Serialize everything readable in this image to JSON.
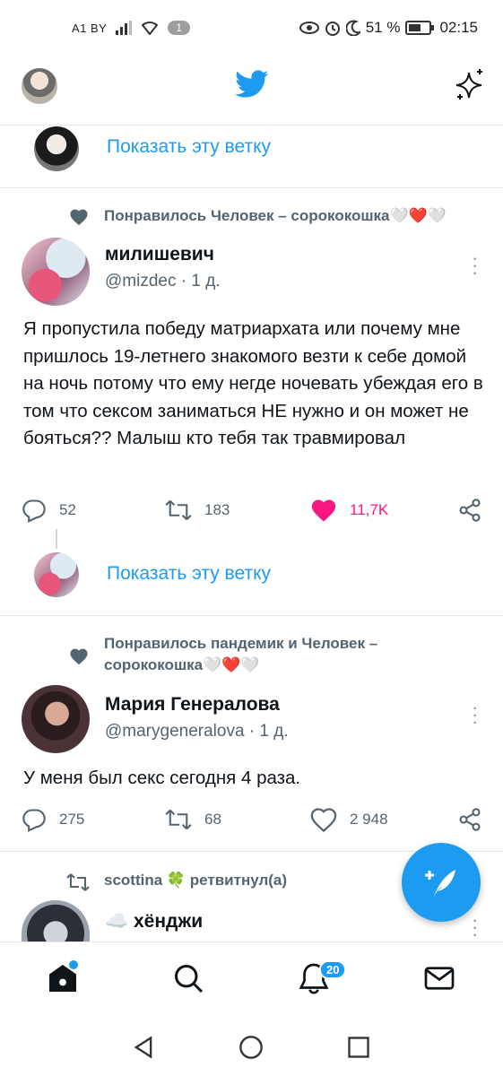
{
  "status_bar": {
    "carrier": "A1 BY",
    "sim_badge": "1",
    "battery": "51 %",
    "time": "02:15"
  },
  "feed": {
    "show_thread_1": "Показать эту ветку",
    "tweet1": {
      "social_context": "Понравилось Человек – сорококошка🤍❤️🤍",
      "name": "милишевич",
      "handle_time": "@mizdec · 1 д.",
      "text": "Я пропустила победу матриархата или почему мне пришлось 19-летнего знакомого везти к себе домой на ночь потому что ему негде ночевать убеждая его в том что сексом заниматься НЕ нужно и он может не бояться?? Малыш кто тебя так травмировал",
      "replies": "52",
      "retweets": "183",
      "likes": "11,7K"
    },
    "show_thread_2": "Показать эту ветку",
    "tweet2": {
      "social_context_line1": "Понравилось пандемик и Человек –",
      "social_context_line2": "сорококошка🤍❤️🤍",
      "name": "Мария Генералова",
      "handle_time": "@marygeneralova · 1 д.",
      "text": "У меня был секс сегодня 4 раза.",
      "replies": "275",
      "retweets": "68",
      "likes": "2 948"
    },
    "tweet3": {
      "social_context": "scottina 🍀 ретвитнул(а)",
      "name": "☁️ хёнджи"
    }
  },
  "bottom_nav": {
    "notifications_badge": "20"
  },
  "icons": {
    "brand": "twitter-bird-icon",
    "accent": "#1d9bf0",
    "like_active": "#f91880"
  }
}
